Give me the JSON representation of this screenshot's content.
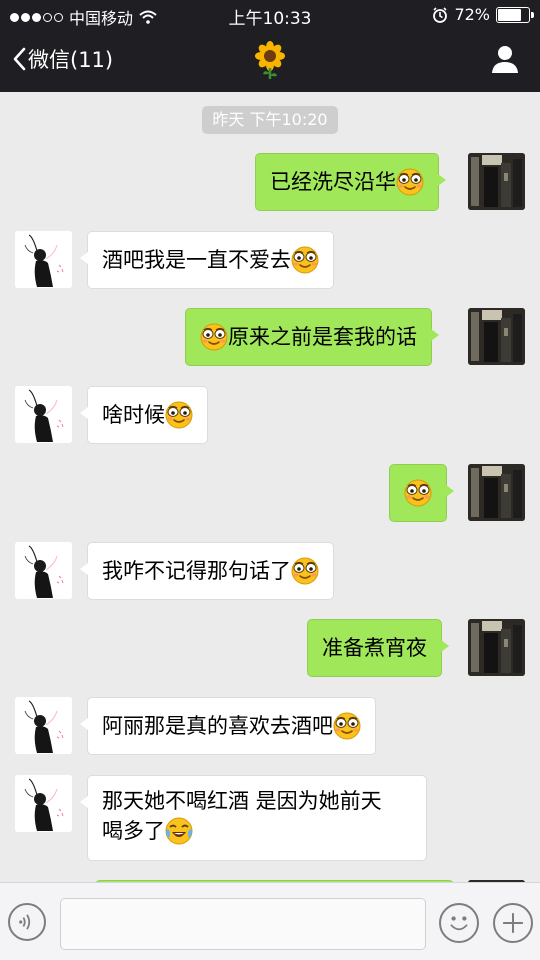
{
  "status_bar": {
    "carrier": "中国移动",
    "time": "上午10:33",
    "battery": "72%",
    "battery_level": 0.72,
    "signal_bars_filled": 3,
    "signal_bars_total": 5
  },
  "nav": {
    "back_label": "微信(11)",
    "title_icon": "sunflower-icon",
    "right_icon": "person-icon"
  },
  "chat": {
    "timestamp": "昨天 下午10:20",
    "messages": [
      {
        "from": "me",
        "text_before": "",
        "text": "已经洗尽沿华",
        "emoji": "smirk-emoji"
      },
      {
        "from": "other",
        "text_before": "",
        "text": "酒吧我是一直不爱去",
        "emoji": "smirk-emoji"
      },
      {
        "from": "me",
        "text_before": "smirk-emoji",
        "text": "原来之前是套我的话",
        "emoji": ""
      },
      {
        "from": "other",
        "text_before": "",
        "text": "啥时候",
        "emoji": "smirk-emoji"
      },
      {
        "from": "me",
        "text_before": "",
        "text": "",
        "emoji": "smirk-emoji"
      },
      {
        "from": "other",
        "text_before": "",
        "text": "我咋不记得那句话了",
        "emoji": "smirk-emoji"
      },
      {
        "from": "me",
        "text_before": "",
        "text": "准备煮宵夜",
        "emoji": ""
      },
      {
        "from": "other",
        "text_before": "",
        "text": "阿丽那是真的喜欢去酒吧",
        "emoji": "smirk-emoji"
      },
      {
        "from": "other",
        "text_before": "",
        "text": "那天她不喝红酒 是因为她前天",
        "text_line2": "喝多了",
        "emoji": "laugh-cry-emoji"
      }
    ]
  },
  "input_bar": {
    "placeholder": "",
    "voice_icon": "voice-icon",
    "emoji_icon": "emoji-icon",
    "plus_icon": "plus-icon"
  },
  "colors": {
    "header_bg": "#1e1e23",
    "chat_bg": "#ebebeb",
    "my_bubble": "#a0e75a",
    "other_bubble": "#ffffff",
    "timestamp_bg": "#cecece"
  }
}
